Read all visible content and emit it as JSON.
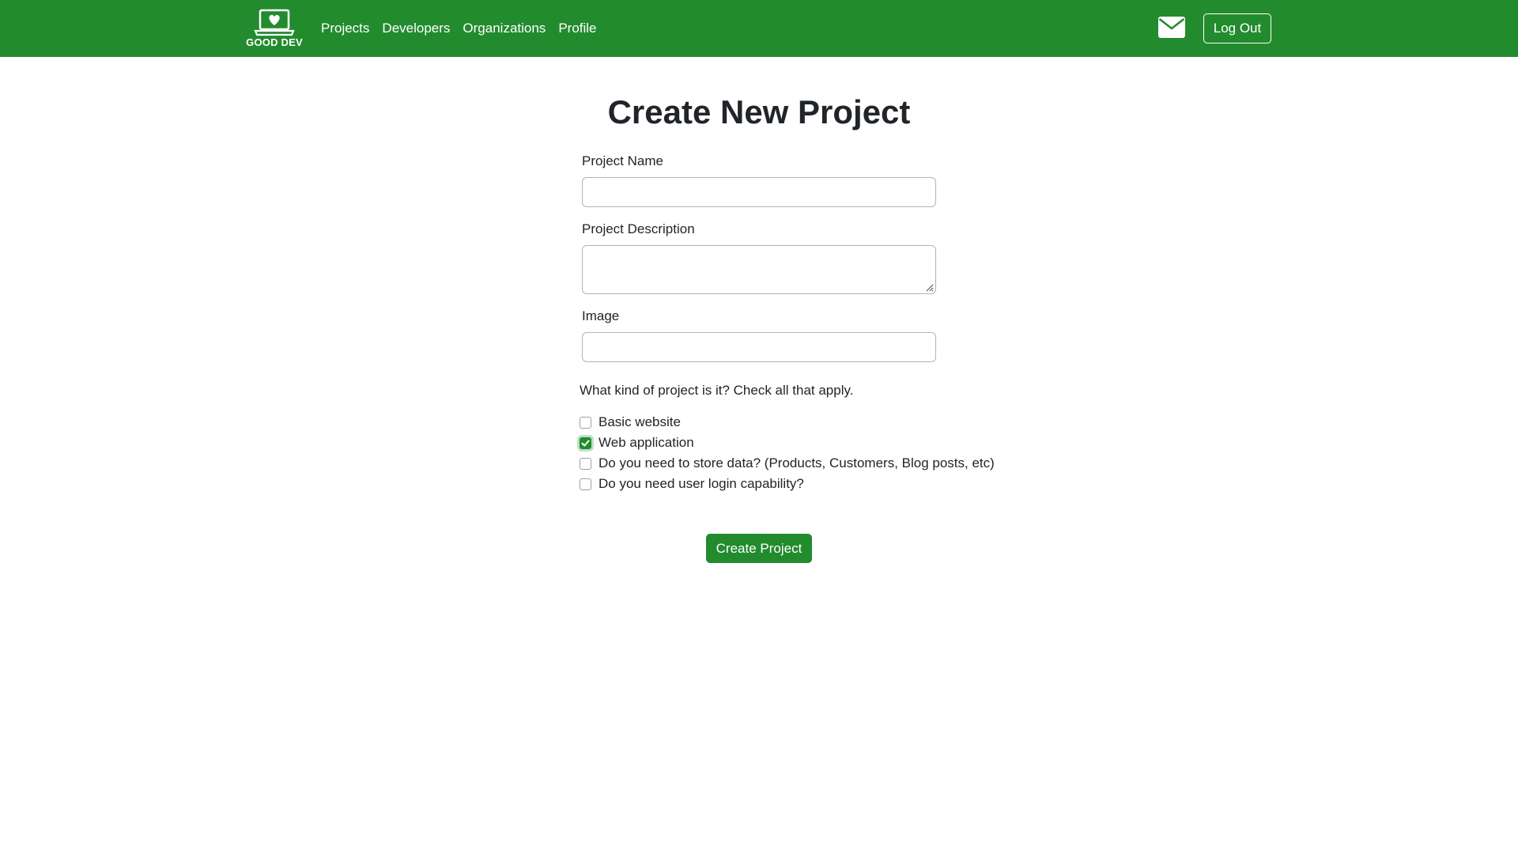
{
  "brand": {
    "logo_text": "GOOD DEV",
    "color": "#228b2e"
  },
  "nav": {
    "links": [
      "Projects",
      "Developers",
      "Organizations",
      "Profile"
    ],
    "mail_icon": "envelope-icon",
    "logout_label": "Log Out"
  },
  "form": {
    "title": "Create New Project",
    "fields": {
      "project_name": {
        "label": "Project Name",
        "value": "",
        "placeholder": ""
      },
      "project_description": {
        "label": "Project Description",
        "value": "",
        "placeholder": ""
      },
      "image": {
        "label": "Image",
        "value": "",
        "placeholder": ""
      }
    },
    "question": "What kind of project is it? Check all that apply.",
    "options": [
      {
        "label": "Basic website",
        "checked": false
      },
      {
        "label": "Web application",
        "checked": true
      },
      {
        "label": "Do you need to store data? (Products, Customers, Blog posts, etc)",
        "checked": false
      },
      {
        "label": "Do you need user login capability?",
        "checked": false
      }
    ],
    "submit_label": "Create Project"
  }
}
